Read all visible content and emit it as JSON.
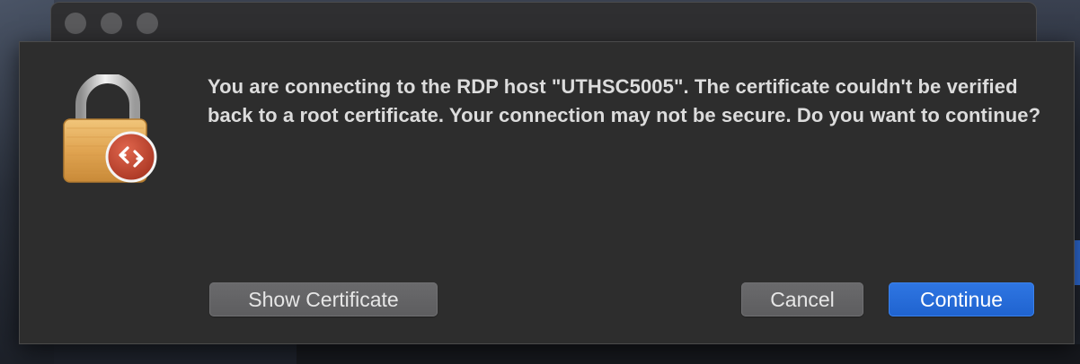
{
  "dialog": {
    "message": "You are connecting to the RDP host \"UTHSC5005\". The certificate couldn't be verified back to a root certificate. Your connection may not be secure. Do you want to continue?",
    "icon": "lock-icon",
    "badge_icon": "remote-desktop-icon",
    "buttons": {
      "show_certificate": "Show Certificate",
      "cancel": "Cancel",
      "continue": "Continue"
    }
  },
  "colors": {
    "dialog_bg": "#2d2d2d",
    "text": "#dcdcdc",
    "button": "#5f5f61",
    "primary": "#2469d9",
    "lock_gold": "#e2a955",
    "badge_red": "#c6452e"
  }
}
